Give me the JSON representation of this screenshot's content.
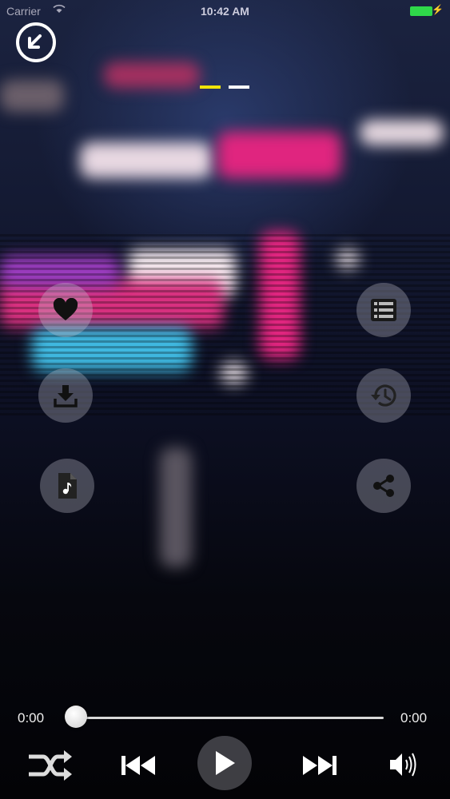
{
  "status_bar": {
    "carrier": "Carrier",
    "time": "10:42 AM"
  },
  "player": {
    "elapsed": "0:00",
    "duration": "0:00",
    "progress": 0
  },
  "page_indicator": {
    "pages": 2,
    "active": 0,
    "active_color": "#f0e40a",
    "inactive_color": "#ffffff"
  },
  "icons": {
    "minimize": "minimize-icon",
    "favorite": "heart-icon",
    "download": "download-icon",
    "audio_file": "music-file-icon",
    "playlist": "list-icon",
    "history": "history-icon",
    "share": "share-icon",
    "shuffle": "shuffle-icon",
    "previous": "previous-track-icon",
    "play": "play-icon",
    "next": "next-track-icon",
    "volume": "volume-icon"
  },
  "colors": {
    "battery": "#2fd84a",
    "accent_pink": "#e0257f",
    "accent_cyan": "#3fb8e0"
  }
}
